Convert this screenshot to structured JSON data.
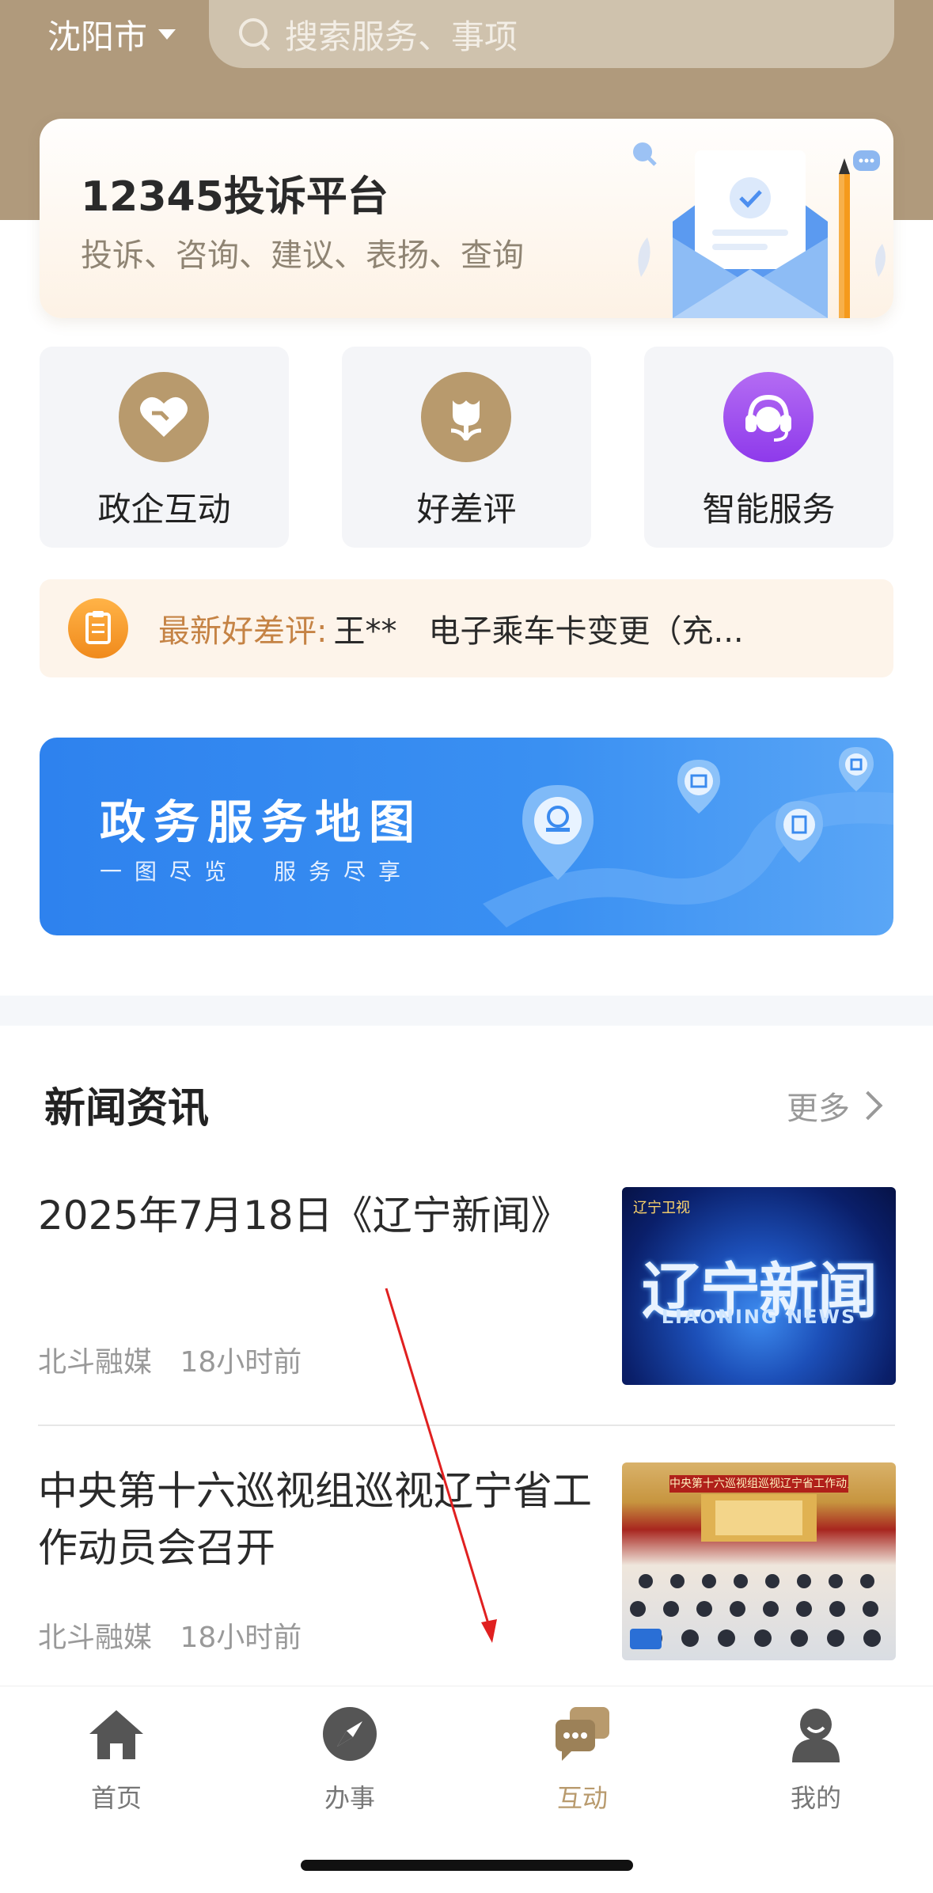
{
  "header": {
    "city": "沈阳市",
    "search_placeholder": "搜索服务、事项"
  },
  "complaint_card": {
    "title": "12345投诉平台",
    "subtitle": "投诉、咨询、建议、表扬、查询"
  },
  "quick_links": [
    {
      "label": "政企互动",
      "icon": "heart-handshake-icon",
      "color": "#b89a6d"
    },
    {
      "label": "好差评",
      "icon": "tulip-icon",
      "color": "#b89a6d"
    },
    {
      "label": "智能服务",
      "icon": "headset-service-icon",
      "color": "#a64df0"
    }
  ],
  "review_bar": {
    "label": "最新好差评:",
    "text": "王**　电子乘车卡变更（充..."
  },
  "map_banner": {
    "title": "政务服务地图",
    "subtitle": "一图尽览　服务尽享"
  },
  "news": {
    "section_title": "新闻资讯",
    "more_label": "更多",
    "items": [
      {
        "title": "2025年7月18日《辽宁新闻》",
        "source": "北斗融媒",
        "time": "18小时前",
        "thumb_text": "辽宁新闻",
        "thumb_sub": "LIAONING NEWS",
        "thumb_logo": "辽宁卫视"
      },
      {
        "title": "中央第十六巡视组巡视辽宁省工作动员会召开",
        "source": "北斗融媒",
        "time": "18小时前",
        "thumb_text": "中央第十六巡视组巡视辽宁省工作动员会"
      }
    ]
  },
  "tabbar": {
    "items": [
      {
        "label": "首页",
        "icon": "home-icon"
      },
      {
        "label": "办事",
        "icon": "compass-icon"
      },
      {
        "label": "互动",
        "icon": "chat-bubbles-icon",
        "active": true
      },
      {
        "label": "我的",
        "icon": "person-icon"
      }
    ]
  },
  "colors": {
    "header_bg": "#b09a7c",
    "accent_gold": "#b89a6d",
    "banner_blue": "#2e82ee",
    "annotation_red": "#e02020"
  }
}
